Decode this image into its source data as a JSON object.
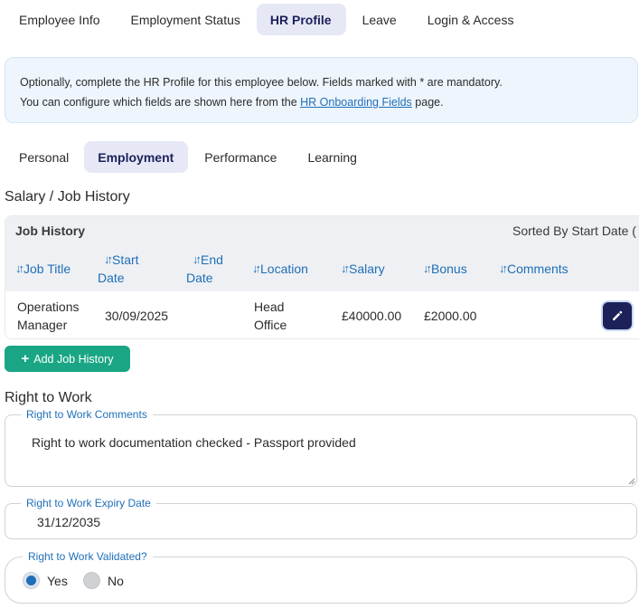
{
  "top_tabs": [
    "Employee Info",
    "Employment Status",
    "HR Profile",
    "Leave",
    "Login & Access"
  ],
  "info": {
    "line1": "Optionally, complete the HR Profile for this employee below. Fields marked with * are mandatory.",
    "line2_before": "You can configure which fields are shown here from the ",
    "line2_link": "HR Onboarding Fields",
    "line2_after": " page."
  },
  "sub_tabs": [
    "Personal",
    "Employment",
    "Performance",
    "Learning"
  ],
  "salary_section": {
    "title": "Salary / Job History",
    "caption": "Job History",
    "sorted_by": "Sorted By Start Date (",
    "columns": [
      {
        "line1": "Job Title",
        "line2": ""
      },
      {
        "line1": "Start",
        "line2": "Date"
      },
      {
        "line1": "End",
        "line2": "Date"
      },
      {
        "line1": "Location",
        "line2": ""
      },
      {
        "line1": "Salary",
        "line2": ""
      },
      {
        "line1": "Bonus",
        "line2": ""
      },
      {
        "line1": "Comments",
        "line2": ""
      }
    ],
    "row": {
      "job_title_1": "Operations",
      "job_title_2": "Manager",
      "start_date": "30/09/2025",
      "end_date": "",
      "location_1": "Head",
      "location_2": "Office",
      "salary": "£40000.00",
      "bonus": "£2000.00",
      "comments": ""
    },
    "add_button": "Add Job History",
    "edit_icon": "pencil-icon"
  },
  "right_to_work": {
    "title": "Right to Work",
    "comments_label": "Right to Work Comments",
    "comments_value": "Right to work documentation checked - Passport provided",
    "expiry_label": "Right to Work Expiry Date",
    "expiry_value": "31/12/2035",
    "validated_label": "Right to Work Validated?",
    "options": [
      "Yes",
      "No"
    ],
    "selected": "Yes"
  },
  "colors": {
    "primary_navy": "#1d2159",
    "accent_blue": "#1f6fb8",
    "add_green": "#1aa685",
    "active_tab_bg": "#e6e8f6",
    "info_bg": "#eef5fd"
  }
}
